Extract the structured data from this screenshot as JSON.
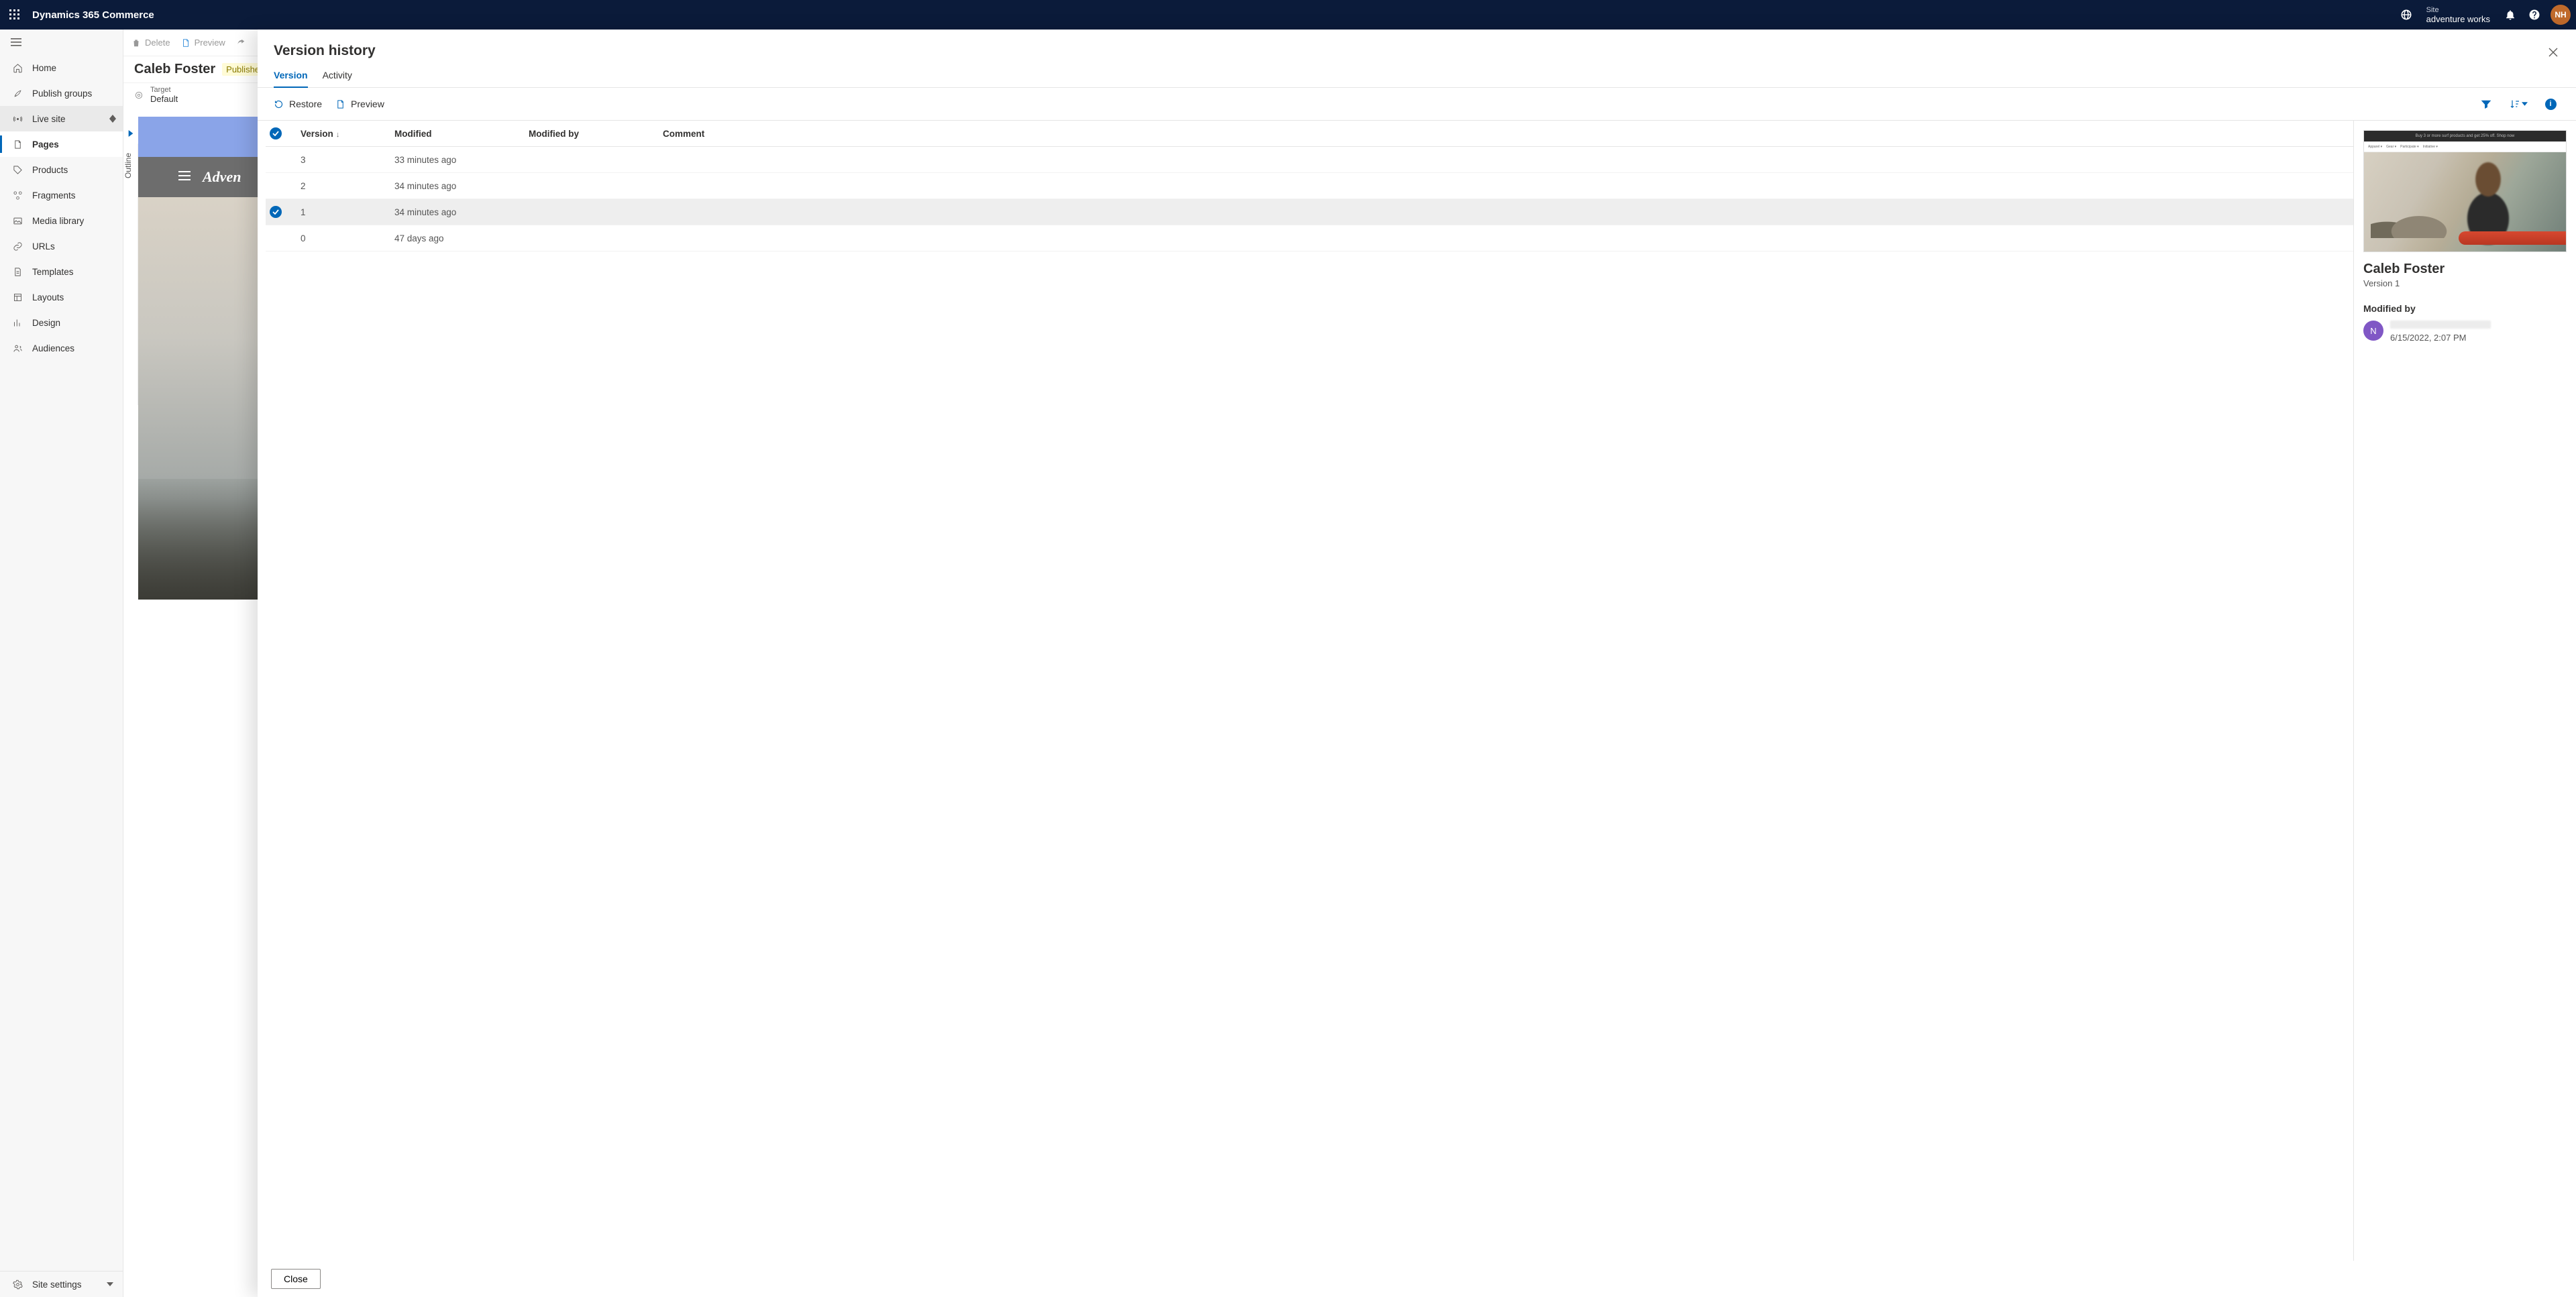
{
  "topbar": {
    "app_title": "Dynamics 365 Commerce",
    "site_label": "Site",
    "site_value": "adventure works",
    "avatar_initials": "NH"
  },
  "sidebar": {
    "items": [
      {
        "label": "Home"
      },
      {
        "label": "Publish groups"
      },
      {
        "label": "Live site"
      },
      {
        "label": "Pages"
      },
      {
        "label": "Products"
      },
      {
        "label": "Fragments"
      },
      {
        "label": "Media library"
      },
      {
        "label": "URLs"
      },
      {
        "label": "Templates"
      },
      {
        "label": "Layouts"
      },
      {
        "label": "Design"
      },
      {
        "label": "Audiences"
      }
    ],
    "footer_label": "Site settings"
  },
  "page": {
    "toolbar": {
      "delete": "Delete",
      "preview": "Preview"
    },
    "title": "Caleb Foster",
    "status": "Published,",
    "target_label": "Target",
    "target_value": "Default",
    "outline_label": "Outline",
    "logo_text": "Adven"
  },
  "panel": {
    "title": "Version history",
    "tabs": {
      "version": "Version",
      "activity": "Activity"
    },
    "toolbar": {
      "restore": "Restore",
      "preview": "Preview"
    },
    "columns": {
      "version": "Version",
      "modified": "Modified",
      "modified_by": "Modified by",
      "comment": "Comment"
    },
    "rows": [
      {
        "version": "3",
        "modified": "33 minutes ago"
      },
      {
        "version": "2",
        "modified": "34 minutes ago"
      },
      {
        "version": "1",
        "modified": "34 minutes ago"
      },
      {
        "version": "0",
        "modified": "47 days ago"
      }
    ],
    "details": {
      "title": "Caleb Foster",
      "version_line": "Version 1",
      "modified_by_heading": "Modified by",
      "persona_initial": "N",
      "modified_date": "6/15/2022, 2:07 PM",
      "banner_text": "Buy 3 or more surf products and get 25% off. Shop now"
    },
    "close": "Close",
    "info_glyph": "i"
  }
}
